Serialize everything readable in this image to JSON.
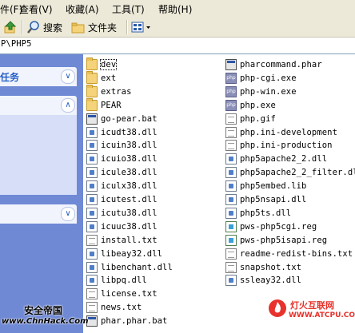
{
  "menubar": {
    "items": [
      "件(F)",
      "查看(V)",
      "收藏(A)",
      "工具(T)",
      "帮助(H)"
    ]
  },
  "toolbar": {
    "search_label": "搜索",
    "folders_label": "文件夹"
  },
  "address": {
    "path": "P\\PHP5"
  },
  "leftpane": {
    "panel1_title": "任务"
  },
  "files": {
    "col1": [
      "dev",
      "ext",
      "extras",
      "PEAR",
      "go-pear.bat",
      "icudt38.dll",
      "icuin38.dll",
      "icuio38.dll",
      "icule38.dll",
      "iculx38.dll",
      "icutest.dll",
      "icutu38.dll",
      "icuuc38.dll",
      "install.txt",
      "libeay32.dll",
      "libenchant.dll",
      "libpq.dll",
      "license.txt",
      "news.txt",
      "phar.phar.bat"
    ],
    "col1_types": [
      "folder",
      "folder",
      "folder",
      "folder",
      "exe",
      "dll",
      "dll",
      "dll",
      "dll",
      "dll",
      "dll",
      "dll",
      "dll",
      "doc",
      "dll",
      "dll",
      "dll",
      "doc",
      "doc",
      "exe"
    ],
    "col2": [
      "pharcommand.phar",
      "php-cgi.exe",
      "php-win.exe",
      "php.exe",
      "php.gif",
      "php.ini-development",
      "php.ini-production",
      "php5apache2_2.dll",
      "php5apache2_2_filter.dll",
      "php5embed.lib",
      "php5nsapi.dll",
      "php5ts.dll",
      "pws-php5cgi.reg",
      "pws-php5isapi.reg",
      "readme-redist-bins.txt",
      "snapshot.txt",
      "ssleay32.dll"
    ],
    "col2_types": [
      "exe",
      "php",
      "php",
      "php",
      "doc",
      "doc",
      "doc",
      "dll",
      "dll",
      "dll",
      "dll",
      "dll",
      "reg",
      "reg",
      "doc",
      "doc",
      "dll"
    ]
  },
  "watermarks": {
    "left_line1": "安全帝国",
    "left_line2": "www.ChnHack.Com",
    "right_line1": "灯火互联网",
    "right_line2": "WWW.ATCPU.COM"
  }
}
